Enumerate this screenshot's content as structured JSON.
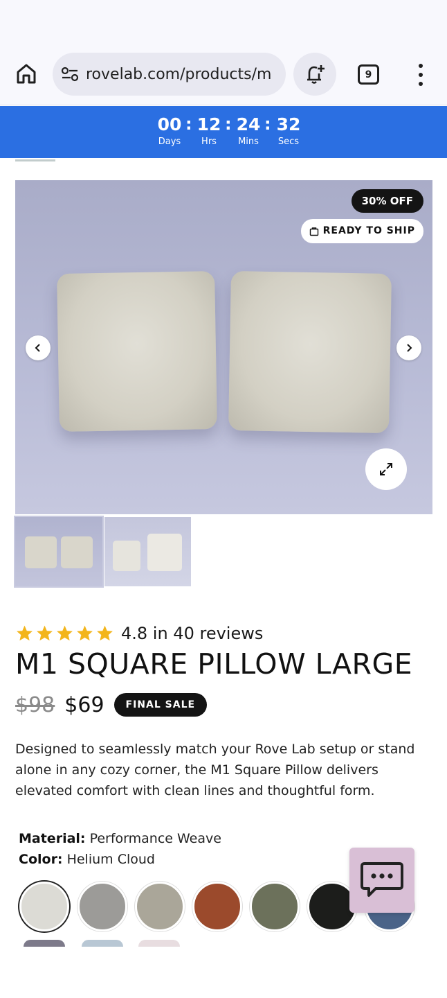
{
  "browser": {
    "url": "rovelab.com/products/m",
    "tab_count": "9"
  },
  "countdown": {
    "days": "00",
    "days_label": "Days",
    "hours": "12",
    "hours_label": "Hrs",
    "mins": "24",
    "mins_label": "Mins",
    "secs": "32",
    "secs_label": "Secs",
    "separator": ":"
  },
  "gallery": {
    "discount_badge": "30% OFF",
    "shipping_badge": "READY TO SHIP"
  },
  "product": {
    "rating_value": 4.8,
    "rating_text": "4.8 in 40 reviews",
    "title": "M1 SQUARE PILLOW LARGE",
    "price_old": "$98",
    "price_new": "$69",
    "sale_badge": "FINAL SALE",
    "description": "Designed to seamlessly match your Rove Lab setup or stand alone in any cozy corner, the M1 Square Pillow delivers elevated comfort with clean lines and thoughtful form.",
    "material_label": "Material:",
    "material_value": "Performance Weave",
    "color_label": "Color:",
    "color_value": "Helium Cloud"
  },
  "swatches": [
    {
      "color": "#dcdbd5",
      "selected": true
    },
    {
      "color": "#9c9b98"
    },
    {
      "color": "#aaa699"
    },
    {
      "color": "#9b4a2c"
    },
    {
      "color": "#6c715b"
    },
    {
      "color": "#1c1d1b"
    },
    {
      "color": "#4a6388"
    }
  ],
  "colors": {
    "countdown_bg": "#2b6fe2",
    "chat_bg": "#d9bfd6",
    "star": "#f3b51b"
  },
  "icons": [
    "home-icon",
    "site-settings-icon",
    "bell-plus-icon",
    "tab-switcher-icon",
    "more-vert-icon",
    "chevron-left-icon",
    "chevron-right-icon",
    "expand-icon",
    "bag-icon",
    "star-icon",
    "chat-icon"
  ]
}
